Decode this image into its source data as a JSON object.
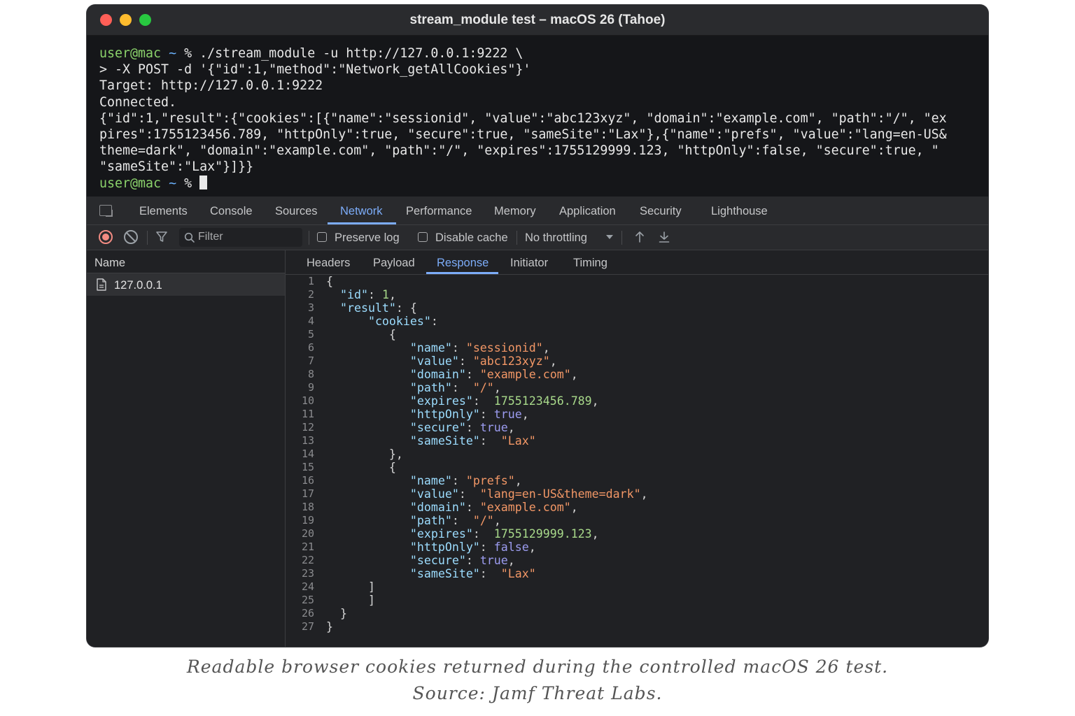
{
  "window": {
    "title": "stream_module test – macOS 26 (Tahoe)"
  },
  "terminal": {
    "prompt_user": "user@mac",
    "prompt_tilde": "~",
    "prompt_sym": "%",
    "command_1": " ./stream_module -u http://127.0.0.1:9222 \\",
    "command_2": "> -X POST -d '{\"id\":1,\"method\":\"Network_getAllCookies\"}'",
    "output": [
      "Target: http://127.0.0.1:9222",
      "Connected.",
      "{\"id\":1,\"result\":{\"cookies\":[{\"name\":\"sessionid\", \"value\":\"abc123xyz\", \"domain\":\"example.com\", \"path\":\"/\", \"ex",
      "pires\":1755123456.789, \"httpOnly\":true, \"secure\":true, \"sameSite\":\"Lax\"},{\"name\":\"prefs\", \"value\":\"lang=en-US&",
      "theme=dark\", \"domain\":\"example.com\", \"path\":\"/\", \"expires\":1755129999.123, \"httpOnly\":false, \"secure\":true, \"",
      "\"sameSite\":\"Lax\"}]}}"
    ]
  },
  "devtools": {
    "tabs": [
      "Elements",
      "Console",
      "Sources",
      "Network",
      "Performance",
      "Memory",
      "Application",
      "Security",
      "Lighthouse"
    ],
    "active_tab": "Network",
    "toolbar": {
      "filter_placeholder": "Filter",
      "preserve_log": "Preserve log",
      "disable_cache": "Disable cache",
      "throttling": "No throttling"
    },
    "name_header": "Name",
    "requests": [
      "127.0.0.1"
    ],
    "detail_tabs": [
      "Headers",
      "Payload",
      "Response",
      "Initiator",
      "Timing"
    ],
    "active_detail_tab": "Response"
  },
  "response_lines": [
    [
      [
        "p",
        "{"
      ]
    ],
    [
      [
        "p",
        "  "
      ],
      [
        "k",
        "\"id\""
      ],
      [
        "p",
        ": "
      ],
      [
        "n",
        "1"
      ],
      [
        "p",
        ","
      ]
    ],
    [
      [
        "p",
        "  "
      ],
      [
        "k",
        "\"result\""
      ],
      [
        "p",
        ": {"
      ]
    ],
    [
      [
        "p",
        "      "
      ],
      [
        "k",
        "\"cookies\""
      ],
      [
        "p",
        ":"
      ]
    ],
    [
      [
        "p",
        "         {"
      ]
    ],
    [
      [
        "p",
        "            "
      ],
      [
        "k",
        "\"name\""
      ],
      [
        "p",
        ": "
      ],
      [
        "s",
        "\"sessionid\""
      ],
      [
        "p",
        ","
      ]
    ],
    [
      [
        "p",
        "            "
      ],
      [
        "k",
        "\"value\""
      ],
      [
        "p",
        ": "
      ],
      [
        "s",
        "\"abc123xyz\""
      ],
      [
        "p",
        ","
      ]
    ],
    [
      [
        "p",
        "            "
      ],
      [
        "k",
        "\"domain\""
      ],
      [
        "p",
        ": "
      ],
      [
        "s",
        "\"example.com\""
      ],
      [
        "p",
        ","
      ]
    ],
    [
      [
        "p",
        "            "
      ],
      [
        "k",
        "\"path\""
      ],
      [
        "p",
        ":  "
      ],
      [
        "s",
        "\"/\""
      ],
      [
        "p",
        ","
      ]
    ],
    [
      [
        "p",
        "            "
      ],
      [
        "k",
        "\"expires\""
      ],
      [
        "p",
        ":  "
      ],
      [
        "n",
        "1755123456.789"
      ],
      [
        "p",
        ","
      ]
    ],
    [
      [
        "p",
        "            "
      ],
      [
        "k",
        "\"httpOnly\""
      ],
      [
        "p",
        ": "
      ],
      [
        "b",
        "true"
      ],
      [
        "p",
        ","
      ]
    ],
    [
      [
        "p",
        "            "
      ],
      [
        "k",
        "\"secure\""
      ],
      [
        "p",
        ": "
      ],
      [
        "b",
        "true"
      ],
      [
        "p",
        ","
      ]
    ],
    [
      [
        "p",
        "            "
      ],
      [
        "k",
        "\"sameSite\""
      ],
      [
        "p",
        ":  "
      ],
      [
        "s",
        "\"Lax\""
      ]
    ],
    [
      [
        "p",
        "         },"
      ]
    ],
    [
      [
        "p",
        "         {"
      ]
    ],
    [
      [
        "p",
        "            "
      ],
      [
        "k",
        "\"name\""
      ],
      [
        "p",
        ": "
      ],
      [
        "s",
        "\"prefs\""
      ],
      [
        "p",
        ","
      ]
    ],
    [
      [
        "p",
        "            "
      ],
      [
        "k",
        "\"value\""
      ],
      [
        "p",
        ":  "
      ],
      [
        "s",
        "\"lang=en-US&theme=dark\""
      ],
      [
        "p",
        ","
      ]
    ],
    [
      [
        "p",
        "            "
      ],
      [
        "k",
        "\"domain\""
      ],
      [
        "p",
        ": "
      ],
      [
        "s",
        "\"example.com\""
      ],
      [
        "p",
        ","
      ]
    ],
    [
      [
        "p",
        "            "
      ],
      [
        "k",
        "\"path\""
      ],
      [
        "p",
        ":  "
      ],
      [
        "s",
        "\"/\""
      ],
      [
        "p",
        ","
      ]
    ],
    [
      [
        "p",
        "            "
      ],
      [
        "k",
        "\"expires\""
      ],
      [
        "p",
        ":  "
      ],
      [
        "n",
        "1755129999.123"
      ],
      [
        "p",
        ","
      ]
    ],
    [
      [
        "p",
        "            "
      ],
      [
        "k",
        "\"httpOnly\""
      ],
      [
        "p",
        ": "
      ],
      [
        "b",
        "false"
      ],
      [
        "p",
        ","
      ]
    ],
    [
      [
        "p",
        "            "
      ],
      [
        "k",
        "\"secure\""
      ],
      [
        "p",
        ": "
      ],
      [
        "b",
        "true"
      ],
      [
        "p",
        ","
      ]
    ],
    [
      [
        "p",
        "            "
      ],
      [
        "k",
        "\"sameSite\""
      ],
      [
        "p",
        ":  "
      ],
      [
        "s",
        "\"Lax\""
      ]
    ],
    [
      [
        "p",
        "      ]"
      ]
    ],
    [
      [
        "p",
        "      ]"
      ]
    ],
    [
      [
        "p",
        "  }"
      ]
    ],
    [
      [
        "p",
        "}"
      ]
    ]
  ],
  "caption": {
    "line1": "Readable browser cookies returned during the controlled macOS 26 test.",
    "line2": "Source: Jamf Threat Labs."
  },
  "colors": {
    "accent": "#7cacf8",
    "prompt_user": "#8bd36b",
    "record": "#f28b82",
    "json_key": "#9cdcfe",
    "json_string": "#f29766",
    "json_number": "#a8d98a",
    "json_bool": "#9c9cf0"
  }
}
